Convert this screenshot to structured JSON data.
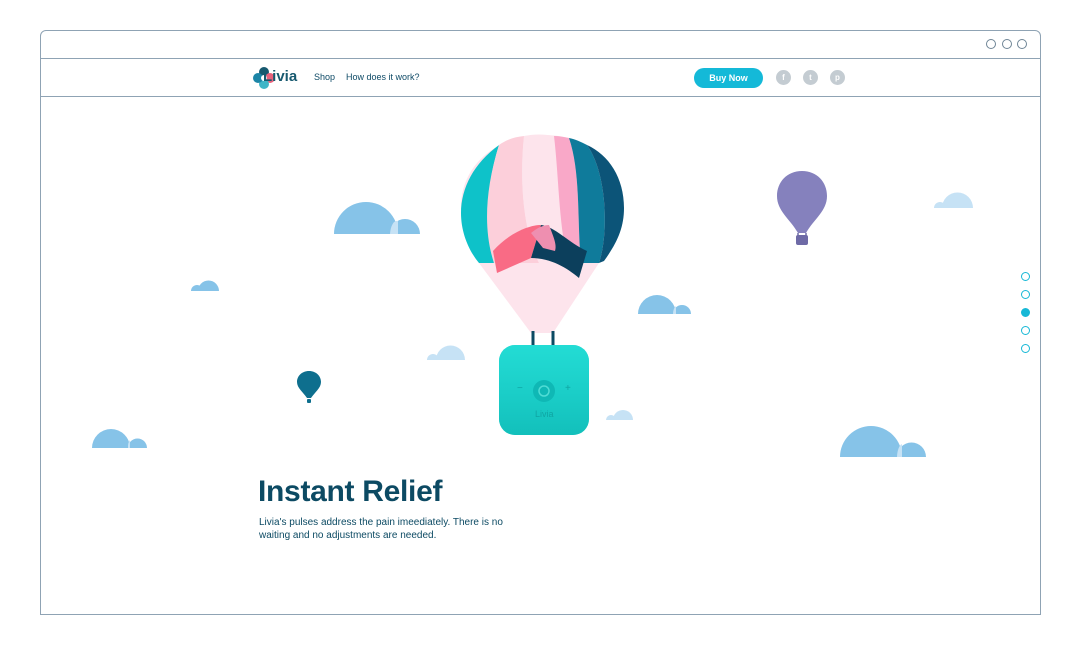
{
  "nav": {
    "logo_text": "Livia",
    "links": [
      "Shop",
      "How does it work?"
    ],
    "buy_button": "Buy Now",
    "social": [
      {
        "icon": "facebook-icon",
        "glyph": "f"
      },
      {
        "icon": "twitter-icon",
        "glyph": "t"
      },
      {
        "icon": "pinterest-icon",
        "glyph": "p"
      }
    ]
  },
  "hero": {
    "title": "Instant Relief",
    "description": "Livia's pulses address the pain imeediately. There is no waiting and no adjustments are needed.",
    "device_label": "Livia",
    "device_minus": "−",
    "device_plus": "+"
  },
  "pagination": {
    "total": 5,
    "active_index": 2
  },
  "colors": {
    "accent": "#14b9d8",
    "text_dark": "#0c4a63",
    "cloud": "#86c3e8",
    "cloud_light": "#c6e2f5",
    "balloon_purple": "#8581bd",
    "balloon_teal": "#0e6f8e",
    "device": "#1ad1c9"
  }
}
